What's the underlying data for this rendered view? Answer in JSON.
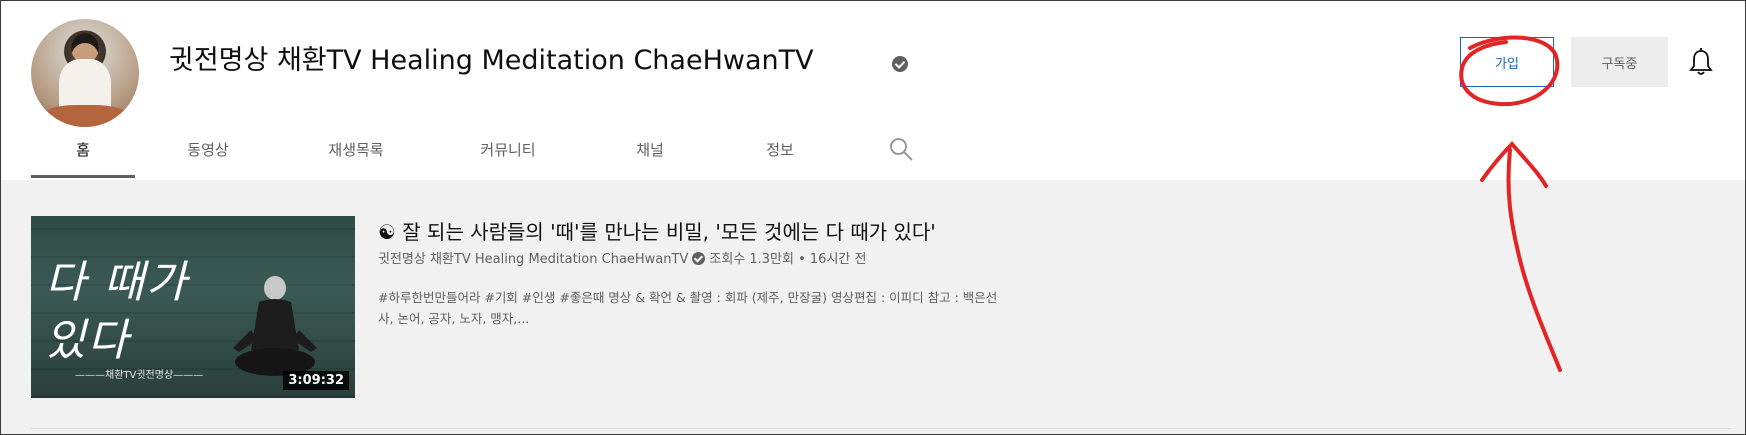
{
  "channel": {
    "title": "귓전명상 채환TV Healing Meditation ChaeHwanTV",
    "join_label": "가입",
    "subscribed_label": "구독중"
  },
  "tabs": [
    {
      "label": "홈",
      "active": true
    },
    {
      "label": "동영상"
    },
    {
      "label": "재생목록"
    },
    {
      "label": "커뮤니티"
    },
    {
      "label": "채널"
    },
    {
      "label": "정보"
    }
  ],
  "video": {
    "title": "☯ 잘 되는 사람들의 '때'를 만나는 비밀, '모든 것에는 다 때가 있다'",
    "channel_name": "귓전명상 채환TV Healing Meditation ChaeHwanTV",
    "views": "조회수 1.3만회",
    "age": "16시간 전",
    "description_line1": "#하루한번만들어라 #기회 #인생 #좋은때 명상 & 확언 & 촬영 : 회파 (제주, 만장굴) 영상편집 : 이피디 참고 : 백은선",
    "description_line2": "사, 논어, 공자, 노자, 맹자,...",
    "duration": "3:09:32",
    "thumb_text_line1": "다 때가",
    "thumb_text_line2": "있다",
    "thumb_tag": "———채환TV귓전명상———"
  },
  "icons": {
    "verified": "verified-check-icon",
    "bell": "notification-bell-icon",
    "search": "search-icon"
  },
  "colors": {
    "join_border": "#1565c0",
    "annotation": "#e32424"
  }
}
